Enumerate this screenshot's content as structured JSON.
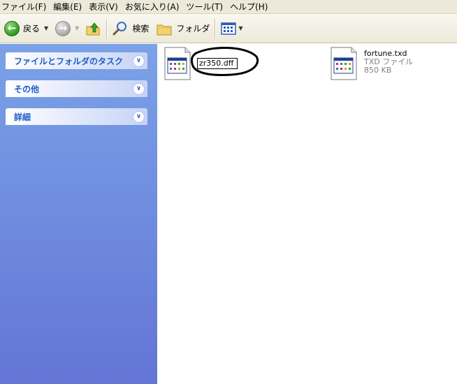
{
  "menu": [
    "ファイル(F)",
    "編集(E)",
    "表示(V)",
    "お気に入り(A)",
    "ツール(T)",
    "ヘルプ(H)"
  ],
  "toolbar": {
    "back_label": "戻る",
    "search_label": "検索",
    "folders_label": "フォルダ"
  },
  "task_pane": {
    "panels": [
      {
        "title": "ファイルとフォルダのタスク",
        "icon": "chevron-double-down-icon"
      },
      {
        "title": "その他",
        "icon": "chevron-double-down-icon"
      },
      {
        "title": "詳細",
        "icon": "chevron-double-down-icon"
      }
    ]
  },
  "files": {
    "renaming": {
      "name_edit_value": "zr350.dff",
      "icon": "application-file-icon"
    },
    "fortune": {
      "name": "fortune.txd",
      "type": "TXD ファイル",
      "size": "850 KB",
      "icon": "application-file-icon"
    }
  },
  "colors": {
    "pane_top": "#7ba2e7",
    "pane_bottom": "#6375d6",
    "panel_title": "#215dc6",
    "toolbar_bg": "#ece9d8"
  }
}
